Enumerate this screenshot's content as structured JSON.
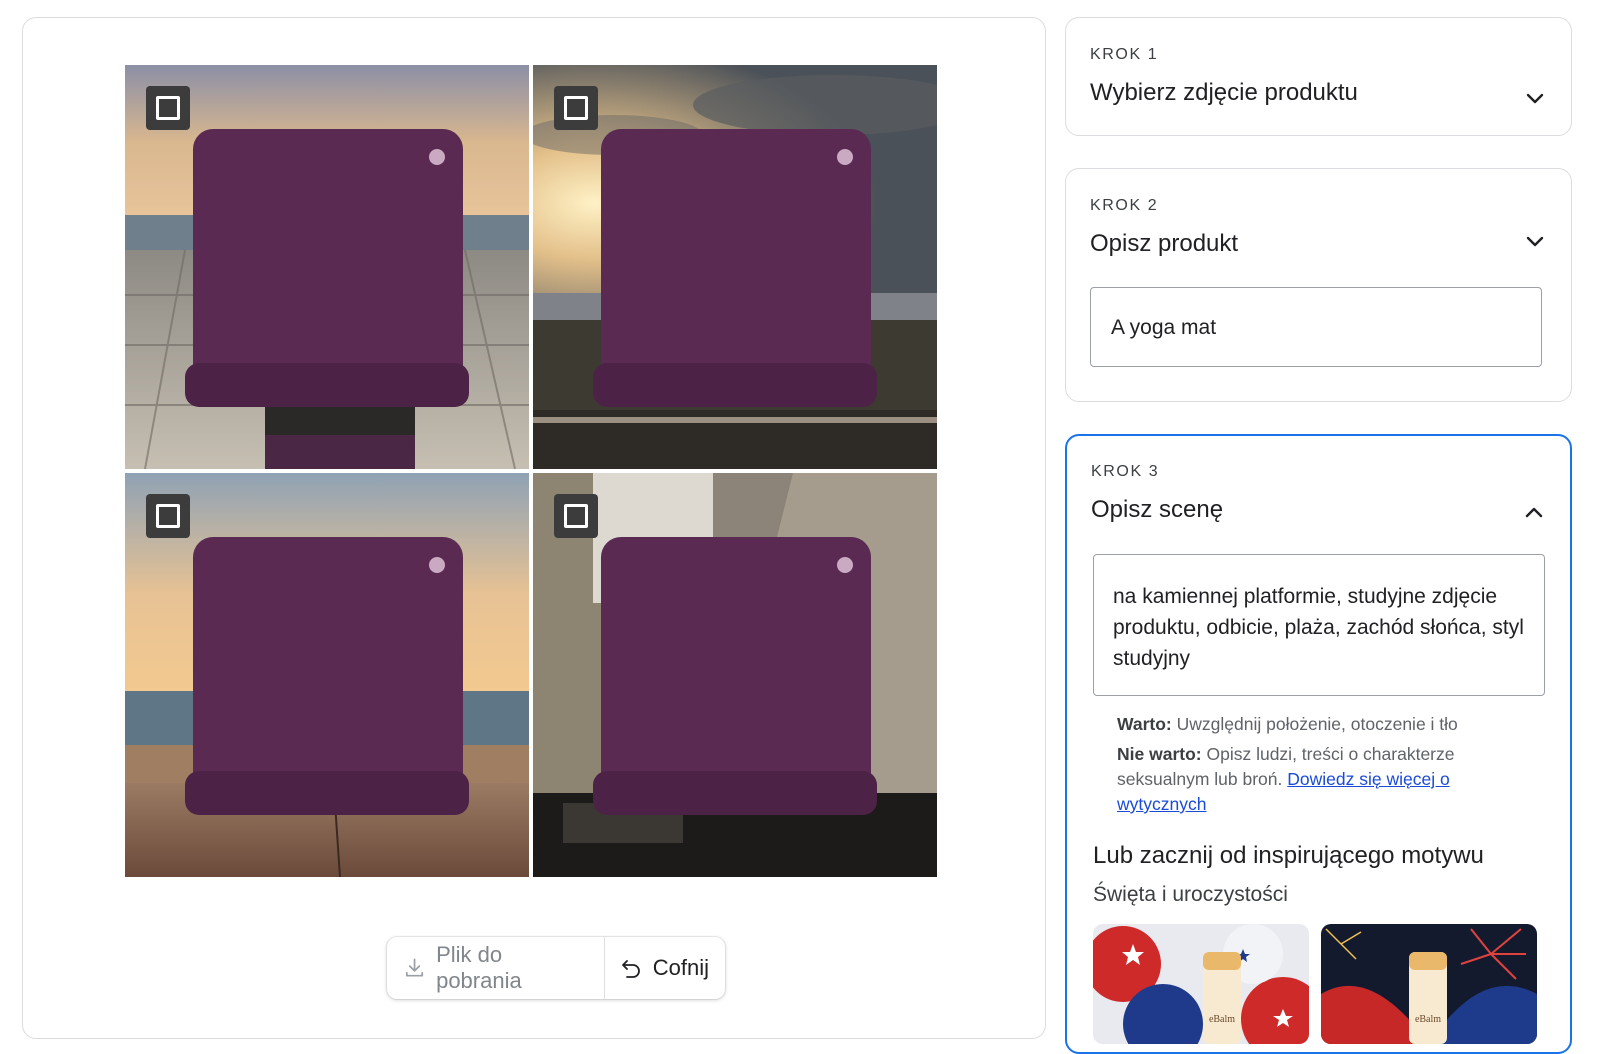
{
  "gallery": {
    "tiles": [
      {
        "name": "generated-image-1",
        "scene": "stone-pier-sea-sunset",
        "selected": false
      },
      {
        "name": "generated-image-2",
        "scene": "sunset-clouds-reflective-platform",
        "selected": false
      },
      {
        "name": "generated-image-3",
        "scene": "beach-sunset-platform",
        "selected": false
      },
      {
        "name": "generated-image-4",
        "scene": "rock-wall-water-reflection",
        "selected": false
      }
    ],
    "product_color": "#5a2a52"
  },
  "actions": {
    "download_label": "Plik do pobrania",
    "undo_label": "Cofnij",
    "download_icon": "download-icon",
    "undo_icon": "undo-icon"
  },
  "steps": [
    {
      "label": "KROK 1",
      "title": "Wybierz zdjęcie produktu",
      "expanded": false
    },
    {
      "label": "KROK 2",
      "title": "Opisz produkt",
      "expanded": false,
      "input_value": "A yoga mat"
    },
    {
      "label": "KROK 3",
      "title": "Opisz scenę",
      "expanded": true,
      "textarea_value": "na kamiennej platformie, studyjne zdjęcie produktu, odbicie, plaża, zachód słońca, styl studyjny"
    }
  ],
  "hints": {
    "do_label": "Warto:",
    "do_text": "Uwzględnij położenie, otoczenie i tło",
    "dont_label": "Nie warto:",
    "dont_text": "Opisz ludzi, treści o charakterze seksualnym lub broń.",
    "link_text": "Dowiedz się więcej o wytycznych"
  },
  "themes": {
    "title": "Lub zacznij od inspirującego motywu",
    "category": "Święta i uroczystości",
    "cards": [
      {
        "name": "theme-balloons-stars",
        "product_label": "eBalm"
      },
      {
        "name": "theme-fireworks-fans",
        "product_label": "eBalm"
      }
    ]
  },
  "colors": {
    "accent": "#1a73e8",
    "border": "#dadce0",
    "link": "#1a4bd8"
  }
}
